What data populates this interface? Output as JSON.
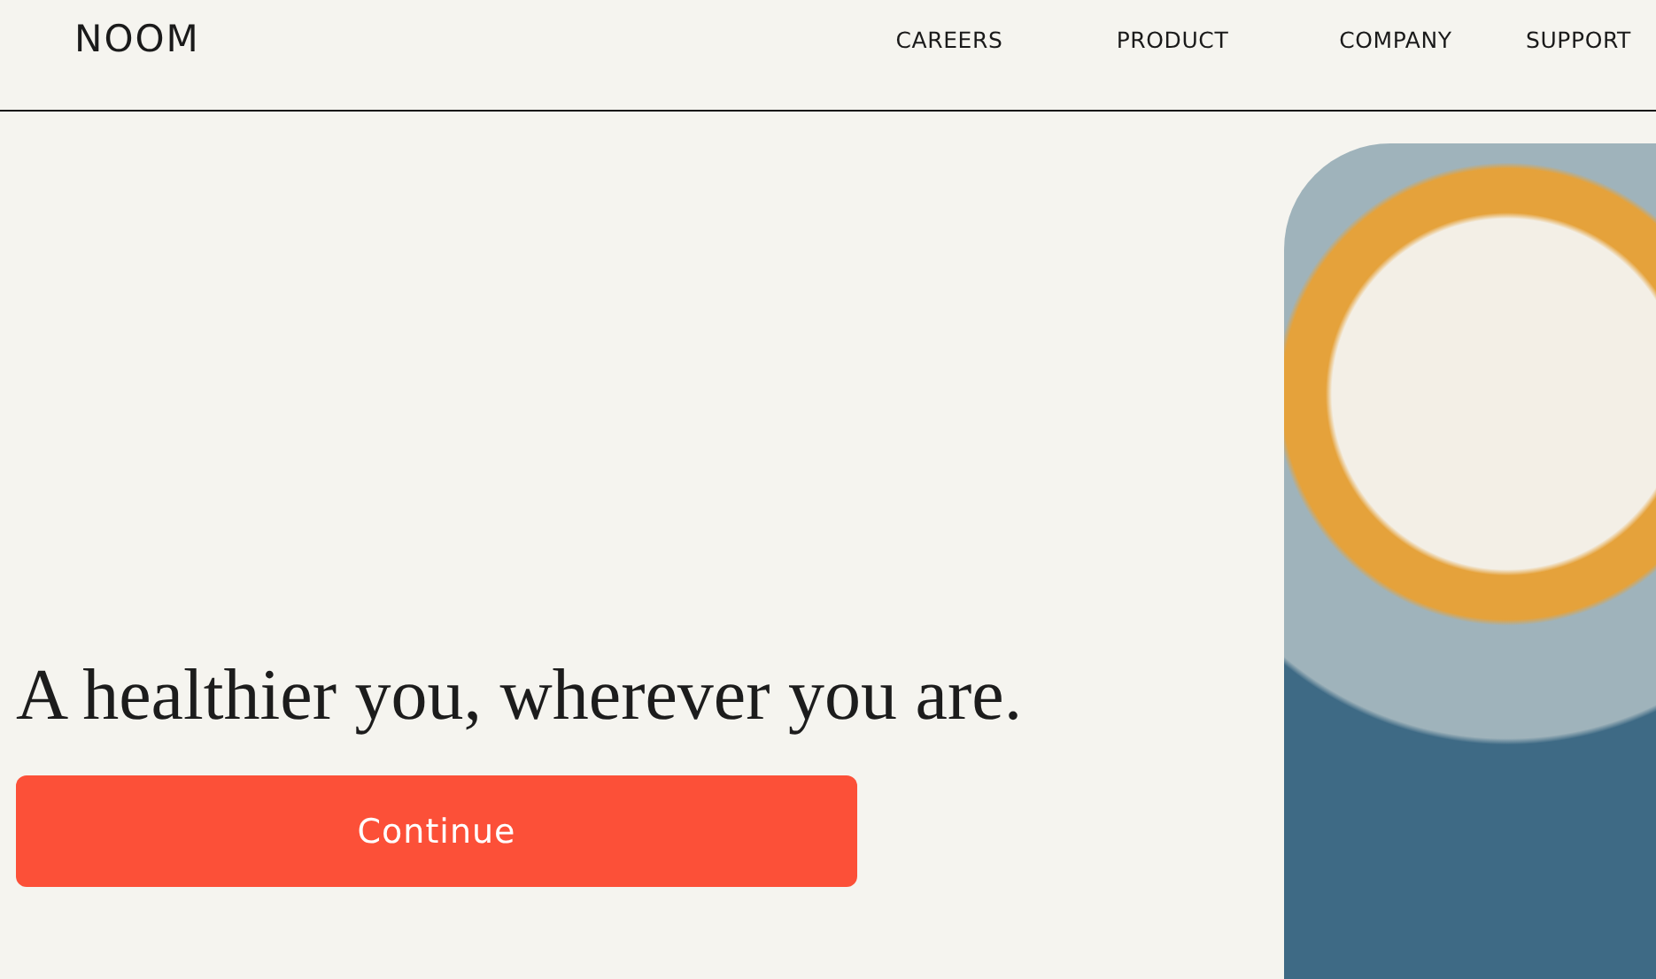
{
  "header": {
    "logo": "NOOM",
    "nav": [
      {
        "label": "CAREERS"
      },
      {
        "label": "PRODUCT"
      },
      {
        "label": "COMPANY"
      },
      {
        "label": "SUPPORT"
      }
    ]
  },
  "hero": {
    "headline": "A healthier you, wherever you are.",
    "button": "Continue"
  }
}
